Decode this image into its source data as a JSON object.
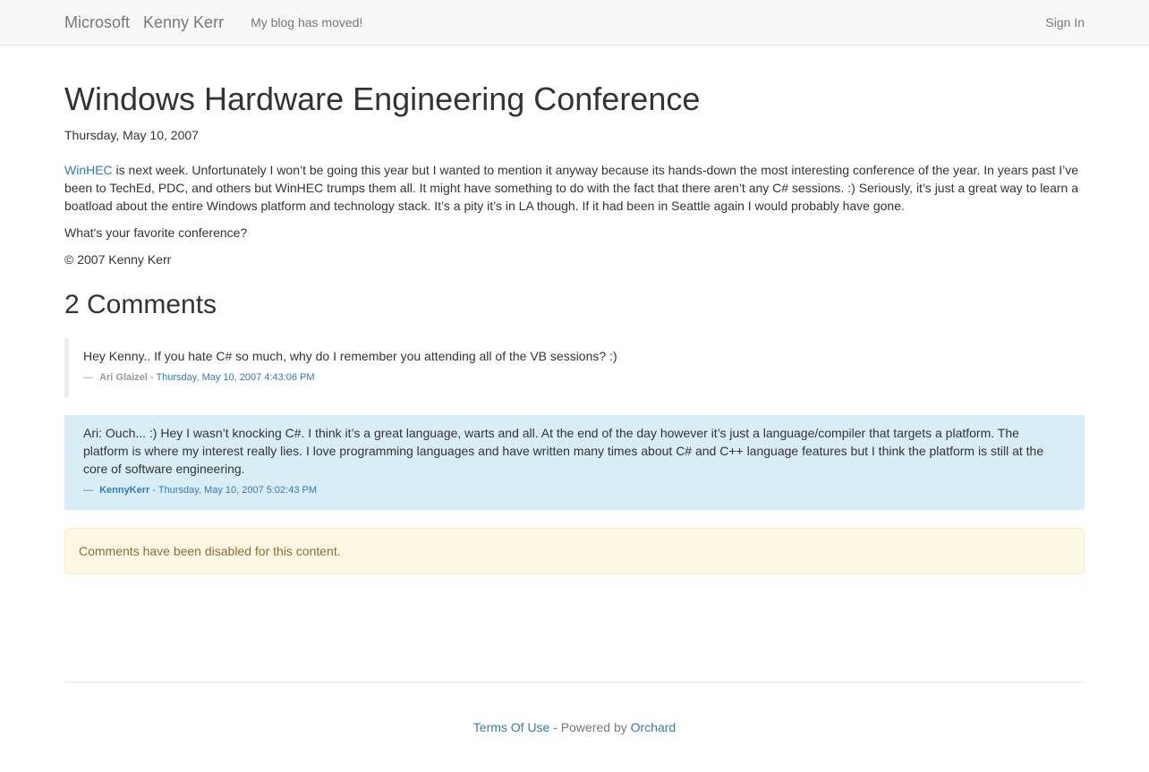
{
  "navbar": {
    "brand_primary": "Microsoft",
    "brand_secondary": "Kenny Kerr",
    "moved_link": "My blog has moved!",
    "sign_in": "Sign In"
  },
  "post": {
    "title": "Windows Hardware Engineering Conference",
    "date": "Thursday, May 10, 2007",
    "winhec_link": "WinHEC",
    "paragraph1": " is next week. Unfortunately I won’t be going this year but I wanted to mention it anyway because its hands-down the most interesting conference of the year. In years past I’ve been to TechEd, PDC, and others but WinHEC trumps them all. It might have something to do with the fact that there aren’t any C# sessions.  :)  Seriously, it’s just a great way to learn a boatload about the entire Windows platform and technology stack. It’s a pity it’s in LA though. If it had been in Seattle again I would probably have gone.",
    "paragraph2": "What's your favorite conference?",
    "copyright": "© 2007 Kenny Kerr"
  },
  "comments": {
    "heading": "2 Comments",
    "items": [
      {
        "text": "Hey Kenny.. If you hate C# so much, why do I remember you attending all of the VB sessions? :)",
        "dash": "—",
        "author": "Ari Glaizel",
        "separator": " - ",
        "timestamp": "Thursday, May 10, 2007 4:43:06 PM"
      },
      {
        "text": "Ari: Ouch... :) Hey I wasn’t knocking C#. I think it’s a great language, warts and all. At the end of the day however it’s just a language/compiler that targets a platform. The platform is where my interest really lies. I love programming languages and have written many times about C# and C++ language features but I think the platform is still at the core of software engineering.",
        "dash": "—",
        "author": "KennyKerr",
        "separator": " - ",
        "timestamp": "Thursday, May 10, 2007 5:02:43 PM"
      }
    ],
    "disabled_notice": "Comments have been disabled for this content."
  },
  "footer": {
    "terms": "Terms Of Use",
    "powered_by": " - Powered by ",
    "orchard": "Orchard"
  },
  "colors": {
    "link": "#337ab7",
    "navbar_bg": "#f8f8f8",
    "highlight_comment_bg": "#d9edf7",
    "alert_bg": "#fcf8e3",
    "alert_text": "#8a6d3b"
  }
}
